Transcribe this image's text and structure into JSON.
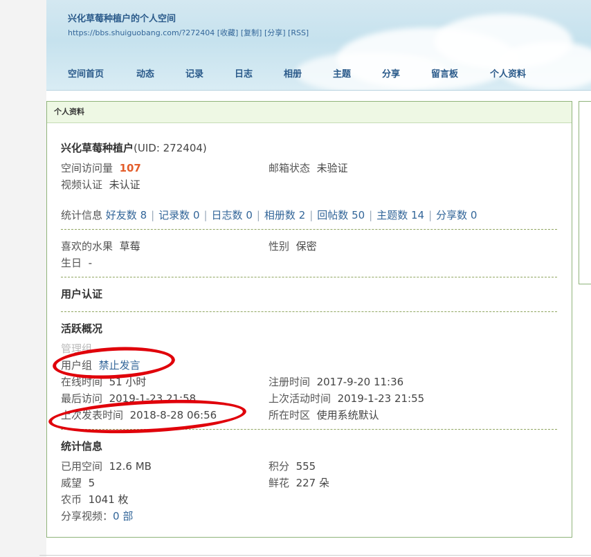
{
  "header": {
    "space_title": "兴化草莓种植户的个人空间",
    "url": "https://bbs.shuiguobang.com/?272404",
    "url_actions": [
      "[收藏]",
      "[复制]",
      "[分享]",
      "[RSS]"
    ]
  },
  "nav": [
    "空间首页",
    "动态",
    "记录",
    "日志",
    "相册",
    "主题",
    "分享",
    "留言板",
    "个人资料"
  ],
  "profile": {
    "box_title": "个人资料",
    "username": "兴化草莓种植户",
    "uid": "(UID: 272404)",
    "visits_label": "空间访问量",
    "visits_value": "107",
    "email_label": "邮箱状态",
    "email_value": "未验证",
    "video_label": "视频认证",
    "video_value": "未认证",
    "stats": {
      "label": "统计信息",
      "items": [
        "好友数 8",
        "记录数 0",
        "日志数 0",
        "相册数 2",
        "回帖数 50",
        "主题数 14",
        "分享数 0"
      ]
    },
    "fruit_label": "喜欢的水果",
    "fruit_value": "草莓",
    "gender_label": "性别",
    "gender_value": "保密",
    "birthday_label": "生日",
    "birthday_value": "-",
    "auth_heading": "用户认证",
    "activity": {
      "heading": "活跃概况",
      "admin_group_label": "管理组",
      "user_group_label": "用户组",
      "user_group_value": "禁止发言",
      "online_label": "在线时间",
      "online_value": "51 小时",
      "register_label": "注册时间",
      "register_value": "2017-9-20 11:36",
      "last_visit_label": "最后访问",
      "last_visit_value": "2019-1-23 21:58",
      "last_active_label": "上次活动时间",
      "last_active_value": "2019-1-23 21:55",
      "last_post_label": "上次发表时间",
      "last_post_value": "2018-8-28 06:56",
      "timezone_label": "所在时区",
      "timezone_value": "使用系统默认"
    },
    "statistics": {
      "heading": "统计信息",
      "space_used_label": "已用空间",
      "space_used_value": "12.6 MB",
      "points_label": "积分",
      "points_value": "555",
      "prestige_label": "威望",
      "prestige_value": "5",
      "flowers_label": "鲜花",
      "flowers_value": "227 朵",
      "coins_label": "农币",
      "coins_value": "1041 枚",
      "videos_label": "分享视频：",
      "videos_value": "0 部"
    }
  },
  "colors": {
    "link": "#336699",
    "annotation": "#e0000a",
    "border": "#8fb37a",
    "accent_number": "#e35d2b"
  }
}
